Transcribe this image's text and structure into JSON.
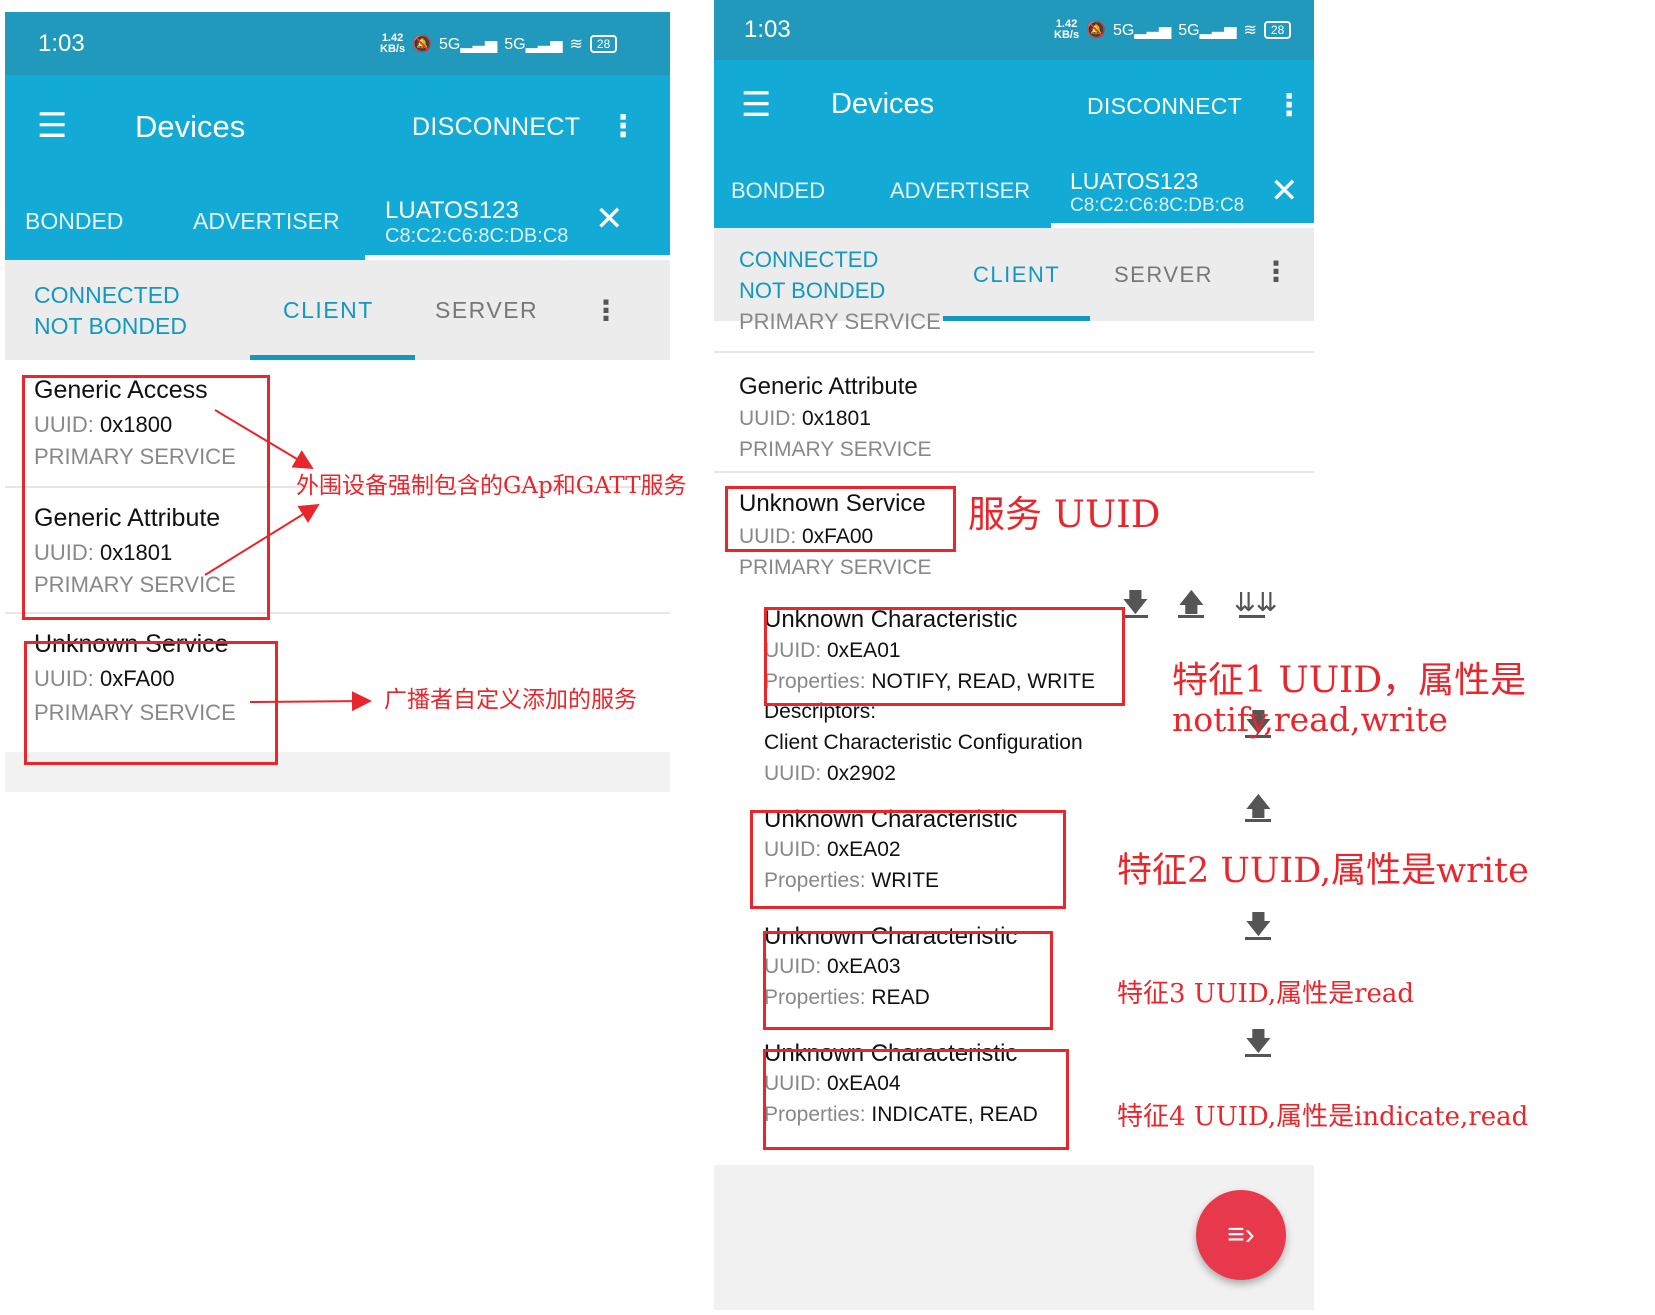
{
  "statusbar": {
    "time": "1:03",
    "speed_top": "1.42",
    "speed_unit": "KB/s",
    "battery": "28"
  },
  "appbar": {
    "menu_icon": "hamburger-menu-icon",
    "title": "Devices",
    "action": "DISCONNECT",
    "more_icon": "more-vert-icon"
  },
  "tabs": {
    "bonded": "BONDED",
    "advertiser": "ADVERTISER",
    "device_name": "LUATOS123",
    "device_mac": "C8:C2:C6:8C:DB:C8",
    "close_icon": "close-icon"
  },
  "connection": {
    "line1": "CONNECTED",
    "line2": "NOT BONDED"
  },
  "client_tabs": {
    "client": "CLIENT",
    "server": "SERVER"
  },
  "labels": {
    "uuid": "UUID: ",
    "properties": "Properties: ",
    "primary": "PRIMARY SERVICE",
    "descriptors": "Descriptors:"
  },
  "left": {
    "services": [
      {
        "name": "Generic Access",
        "uuid": "0x1800"
      },
      {
        "name": "Generic Attribute",
        "uuid": "0x1801"
      },
      {
        "name": "Unknown Service",
        "uuid": "0xFA00"
      }
    ],
    "annotations": {
      "gap_gatt": "外围设备强制包含的GAp和GATT服务",
      "custom": "广播者自定义添加的服务"
    }
  },
  "right": {
    "partial_header": "PRIMARY SERVICE",
    "services": [
      {
        "name": "Generic Attribute",
        "uuid": "0x1801"
      },
      {
        "name": "Unknown Service",
        "uuid": "0xFA00"
      }
    ],
    "characteristics": [
      {
        "name": "Unknown Characteristic",
        "uuid": "0xEA01",
        "properties": "NOTIFY, READ, WRITE"
      },
      {
        "name": "Unknown Characteristic",
        "uuid": "0xEA02",
        "properties": "WRITE"
      },
      {
        "name": "Unknown Characteristic",
        "uuid": "0xEA03",
        "properties": "READ"
      },
      {
        "name": "Unknown Characteristic",
        "uuid": "0xEA04",
        "properties": "INDICATE, READ"
      }
    ],
    "descriptor": {
      "name": "Client Characteristic Configuration",
      "uuid": "0x2902"
    },
    "annotations": {
      "service_uuid": "服务 UUID",
      "char1_line1": "特征1 UUID，属性是",
      "char1_line2": "notify,read,write",
      "char2": "特征2 UUID,属性是write",
      "char3": "特征3 UUID,属性是read",
      "char4": "特征4 UUID,属性是indicate,read"
    },
    "fab_icon": "queue-list-icon"
  },
  "colors": {
    "statusbar": "#2199bd",
    "appbar": "#14aad6",
    "accent": "#1398c0",
    "annotation": "#e8262b",
    "fab": "#e8394c"
  }
}
